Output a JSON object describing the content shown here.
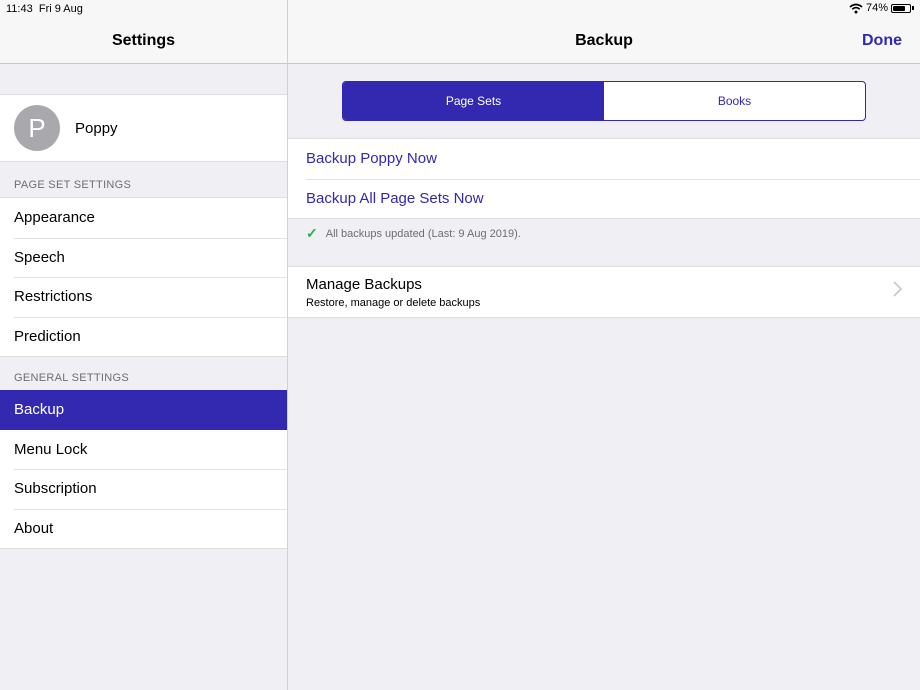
{
  "status_bar": {
    "time": "11:43",
    "date": "Fri 9 Aug",
    "battery_text": "74%",
    "battery_level": 0.74
  },
  "sidebar": {
    "title": "Settings",
    "profile": {
      "initial": "P",
      "name": "Poppy"
    },
    "page_set_section": "PAGE SET SETTINGS",
    "page_set_items": [
      {
        "label": "Appearance"
      },
      {
        "label": "Speech"
      },
      {
        "label": "Restrictions"
      },
      {
        "label": "Prediction"
      }
    ],
    "general_section": "GENERAL SETTINGS",
    "general_items": [
      {
        "label": "Backup",
        "selected": true
      },
      {
        "label": "Menu Lock"
      },
      {
        "label": "Subscription"
      },
      {
        "label": "About"
      }
    ]
  },
  "main": {
    "title": "Backup",
    "done_label": "Done",
    "segments": [
      {
        "label": "Page Sets",
        "active": true
      },
      {
        "label": "Books"
      }
    ],
    "actions": [
      {
        "label": "Backup Poppy Now"
      },
      {
        "label": "Backup All Page Sets Now"
      }
    ],
    "status_note": "All backups updated (Last: 9 Aug 2019).",
    "manage": {
      "title": "Manage Backups",
      "subtitle": "Restore, manage or delete backups"
    }
  },
  "colors": {
    "accent": "#3329b0",
    "check": "#1db44a"
  }
}
